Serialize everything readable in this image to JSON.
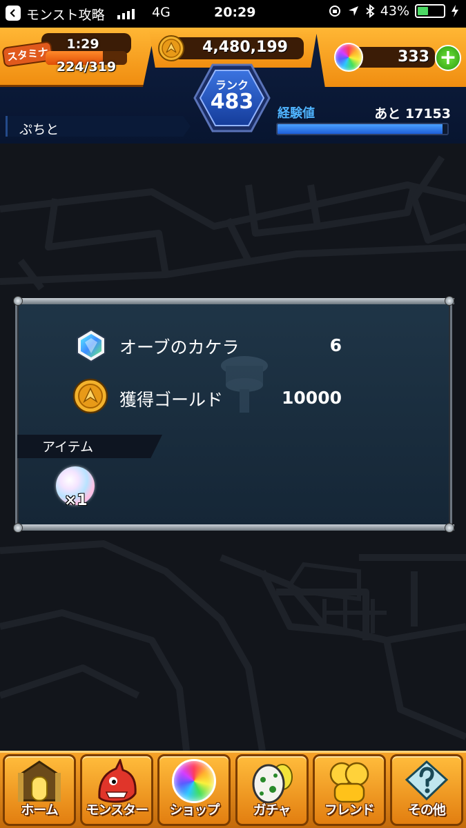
{
  "status_bar": {
    "app_name": "モンスト攻略",
    "network": "4G",
    "time": "20:29",
    "battery": "43%",
    "battery_level": 0.43
  },
  "header": {
    "stamina": {
      "label": "スタミナ",
      "timer": "1:29",
      "current": "224/319",
      "fill_fraction": 0.7
    },
    "gold": "4,480,199",
    "orbs": "333",
    "rank": {
      "label": "ランク",
      "value": "483"
    },
    "player_name": "ぷちと",
    "exp": {
      "label": "経験値",
      "remaining": "あと 17153",
      "fill_fraction": 0.97
    }
  },
  "reward": {
    "rows": [
      {
        "icon": "orb-fragment-icon",
        "label": "オーブのカケラ",
        "value": "6"
      },
      {
        "icon": "gold-coin-icon",
        "label": "獲得ゴールド",
        "value": "10000"
      }
    ],
    "items_tab": "アイテム",
    "items": [
      {
        "icon": "rainbow-pearl-icon",
        "qty": "×1"
      }
    ]
  },
  "nav": [
    {
      "icon": "home-gate-icon",
      "label": "ホーム"
    },
    {
      "icon": "monster-dragon-icon",
      "label": "モンスター"
    },
    {
      "icon": "orb-shop-icon",
      "label": "ショップ"
    },
    {
      "icon": "gacha-egg-icon",
      "label": "ガチャ"
    },
    {
      "icon": "friend-balloon-icon",
      "label": "フレンド"
    },
    {
      "icon": "other-question-icon",
      "label": "その他"
    }
  ],
  "colors": {
    "accent_orange": "#f08d10",
    "exp_blue": "#1e5fd8",
    "panel_bg": "#1f3547",
    "orb_plus_green": "#2b9b10"
  }
}
